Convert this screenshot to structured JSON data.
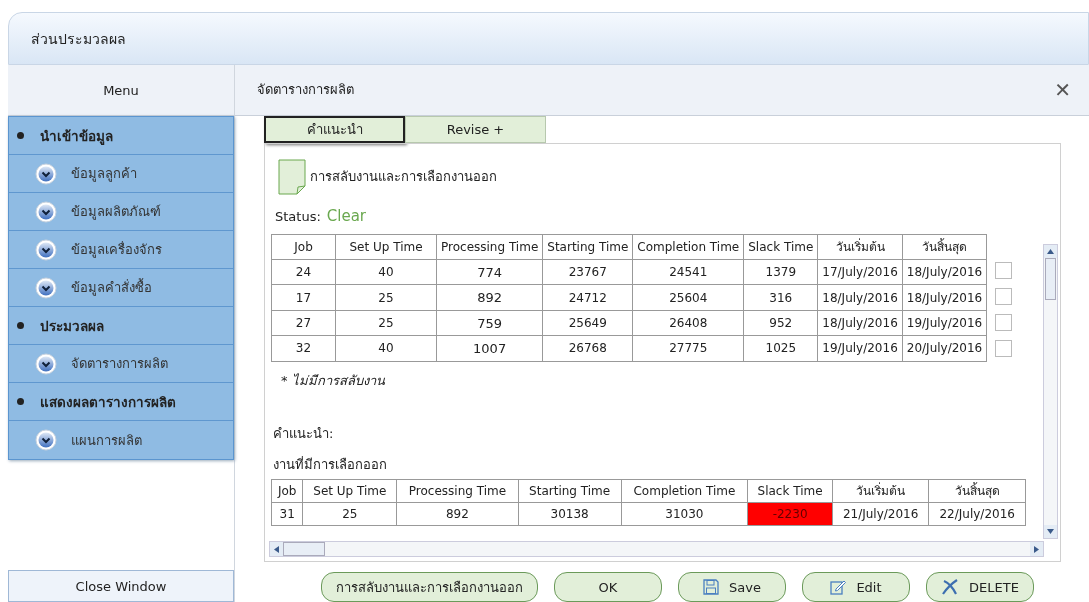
{
  "window": {
    "title": "ส่วนประมวลผล"
  },
  "sidebar": {
    "header": "Menu",
    "groups": [
      {
        "label": "นำเข้าข้อมูล",
        "children": [
          {
            "label": "ข้อมูลลูกค้า"
          },
          {
            "label": "ข้อมูลผลิตภัณฑ์"
          },
          {
            "label": "ข้อมูลเครื่องจักร"
          },
          {
            "label": "ข้อมูลคำสั่งซื้อ"
          }
        ]
      },
      {
        "label": "ประมวลผล",
        "children": [
          {
            "label": "จัดตารางการผลิต"
          }
        ]
      },
      {
        "label": "แสดงผลตารางการผลิต",
        "children": [
          {
            "label": "แผนการผลิต"
          }
        ]
      }
    ],
    "close_button": "Close Window"
  },
  "panel": {
    "title": "จัดตารางการผลิต",
    "close": "✕",
    "tabs": [
      {
        "label": "คำแนะนำ",
        "selected": true
      },
      {
        "label": "Revise +",
        "selected": false
      }
    ],
    "document_label": "การสลับงานและการเลือกงานออก",
    "status_label": "Status:",
    "status_value": "Clear",
    "schedule_table": {
      "columns": [
        "Job",
        "Set Up Time",
        "Processing Time",
        "Starting Time",
        "Completion Time",
        "Slack Time",
        "วันเริ่มต้น",
        "วันสิ้นสุด"
      ],
      "rows": [
        {
          "cells": [
            "24",
            "40",
            "774",
            "23767",
            "24541",
            "1379",
            "17/July/2016",
            "18/July/2016"
          ],
          "checked": false
        },
        {
          "cells": [
            "17",
            "25",
            "892",
            "24712",
            "25604",
            "316",
            "18/July/2016",
            "18/July/2016"
          ],
          "checked": false
        },
        {
          "cells": [
            "27",
            "25",
            "759",
            "25649",
            "26408",
            "952",
            "18/July/2016",
            "19/July/2016"
          ],
          "checked": false
        },
        {
          "cells": [
            "32",
            "40",
            "1007",
            "26768",
            "27775",
            "1025",
            "19/July/2016",
            "20/July/2016"
          ],
          "checked": false
        }
      ]
    },
    "note": "* ไม่มีการสลับงาน",
    "advice_label": "คำแนะนำ:",
    "removed_label": "งานที่มีการเลือกออก",
    "removed_table": {
      "columns": [
        "Job",
        "Set Up Time",
        "Processing Time",
        "Starting Time",
        "Completion Time",
        "Slack Time",
        "วันเริ่มต้น",
        "วันสิ้นสุด"
      ],
      "rows": [
        {
          "cells": [
            "31",
            "25",
            "892",
            "30138",
            "31030",
            "-2230",
            "21/July/2016",
            "22/July/2016"
          ],
          "slack_alert": true
        }
      ]
    },
    "buttons": [
      {
        "label": "การสลับงานและการเลือกงานออก",
        "kind": "plain"
      },
      {
        "label": "OK",
        "kind": "plain"
      },
      {
        "label": "Save",
        "kind": "save"
      },
      {
        "label": "Edit",
        "kind": "edit"
      },
      {
        "label": "DELETE",
        "kind": "delete"
      }
    ]
  }
}
